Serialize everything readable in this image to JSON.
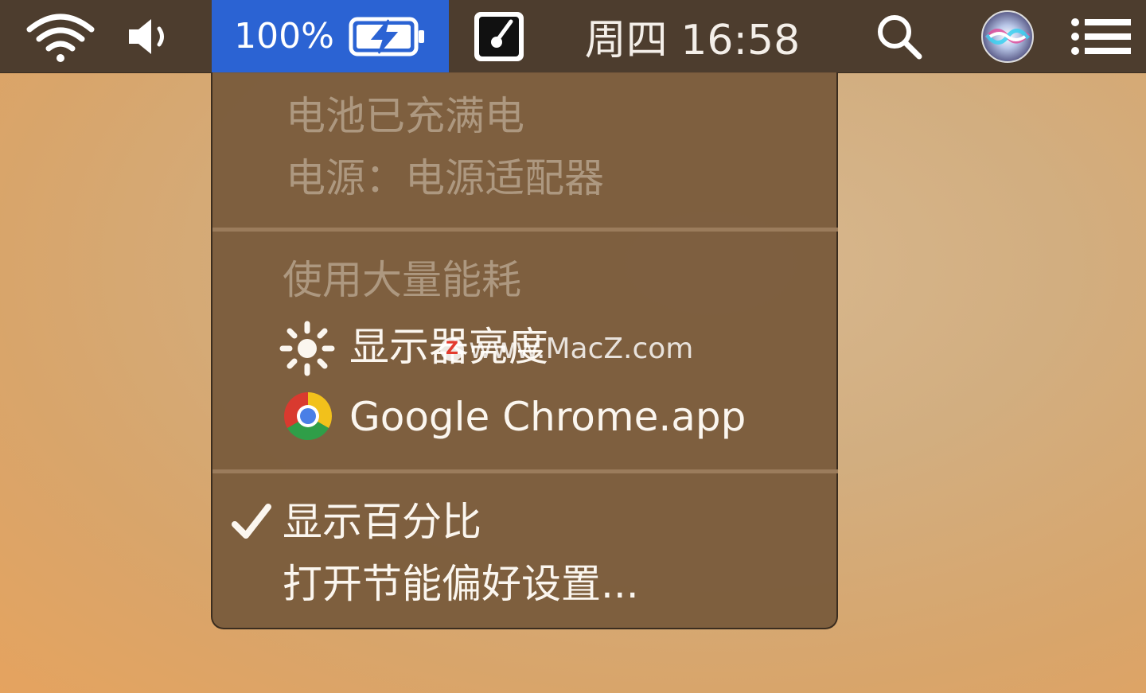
{
  "menubar": {
    "battery": {
      "percent_text": "100%",
      "level": 1.0,
      "charging": true
    },
    "clock": "周四 16:58",
    "icons": {
      "wifi": "wifi-icon",
      "volume": "volume-icon",
      "app": "app-status-icon",
      "spotlight": "search-icon",
      "siri": "siri-icon",
      "notifications": "notification-center-icon"
    },
    "highlight_color": "#2b63d3"
  },
  "battery_menu": {
    "status_line1": "电池已充满电",
    "status_line2": "电源：电源适配器",
    "heavy_usage_header": "使用大量能耗",
    "heavy_usage_items": [
      {
        "icon": "brightness-icon",
        "label": "显示器亮度"
      },
      {
        "icon": "chrome-icon",
        "label": "Google Chrome.app"
      }
    ],
    "show_percentage": {
      "label": "显示百分比",
      "checked": true
    },
    "open_prefs": "打开节能偏好设置..."
  },
  "watermark": {
    "logo_letter": "Z",
    "text": "www.MacZ.com"
  }
}
